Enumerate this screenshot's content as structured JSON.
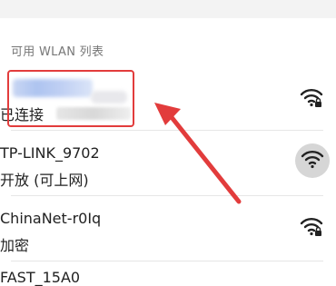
{
  "header": {
    "title": "可用 WLAN 列表"
  },
  "networks": [
    {
      "ssid": "",
      "status": "已连接",
      "icon": "wifi-locked-icon",
      "highlighted": true
    },
    {
      "ssid": "TP-LINK_9702",
      "status": "开放 (可上网)",
      "icon": "wifi-open-icon",
      "pressed": true
    },
    {
      "ssid": "ChinaNet-r0Iq",
      "status": "加密",
      "icon": "wifi-locked-icon"
    },
    {
      "ssid": "FAST_15A0"
    }
  ],
  "annotation": {
    "color": "#e23c3c",
    "icon": "red-arrow"
  }
}
